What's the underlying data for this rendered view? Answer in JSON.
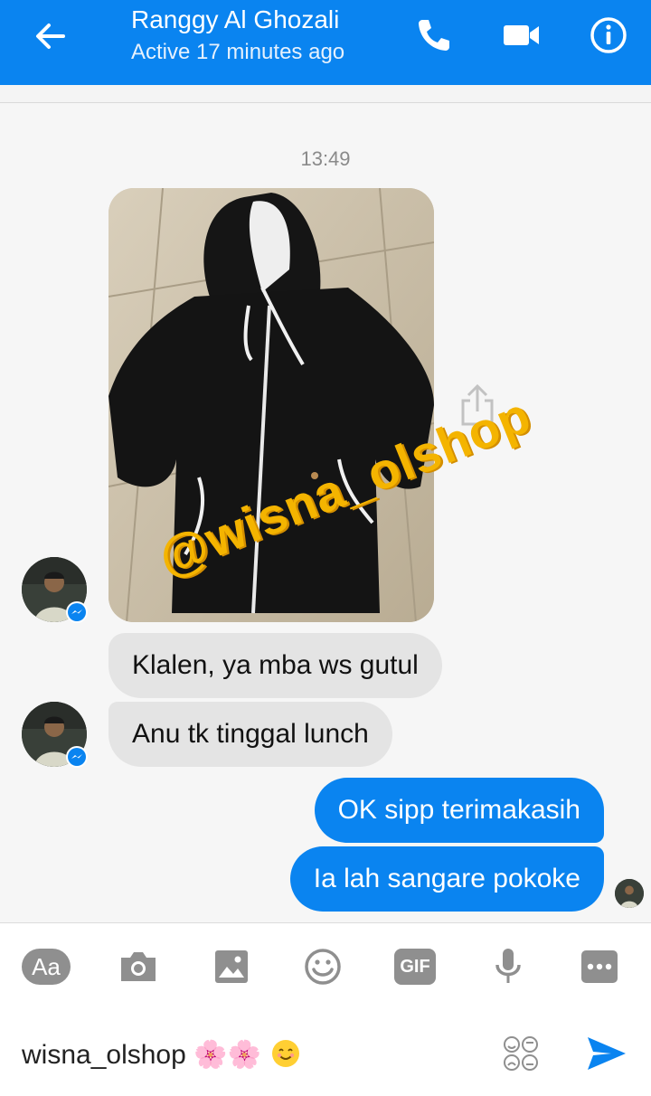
{
  "header": {
    "title": "Ranggy Al Ghozali",
    "status": "Active 17 minutes ago"
  },
  "chat": {
    "timestamp": "13:49",
    "watermark": "@wisna_olshop",
    "messages": [
      {
        "text": "Klalen, ya mba ws gutul",
        "direction": "incoming"
      },
      {
        "text": "Anu tk tinggal lunch",
        "direction": "incoming"
      },
      {
        "text": "OK sipp terimakasih",
        "direction": "outgoing"
      },
      {
        "text": "Ia lah sangare pokoke",
        "direction": "outgoing"
      }
    ]
  },
  "composer": {
    "aa_label": "Aa",
    "gif_label": "GIF",
    "input_text": "wisna_olshop",
    "input_emoji": "🌸🌸"
  },
  "colors": {
    "brand": "#0a84f0",
    "incoming_bubble": "#e4e4e4",
    "watermark": "#f4b400"
  }
}
